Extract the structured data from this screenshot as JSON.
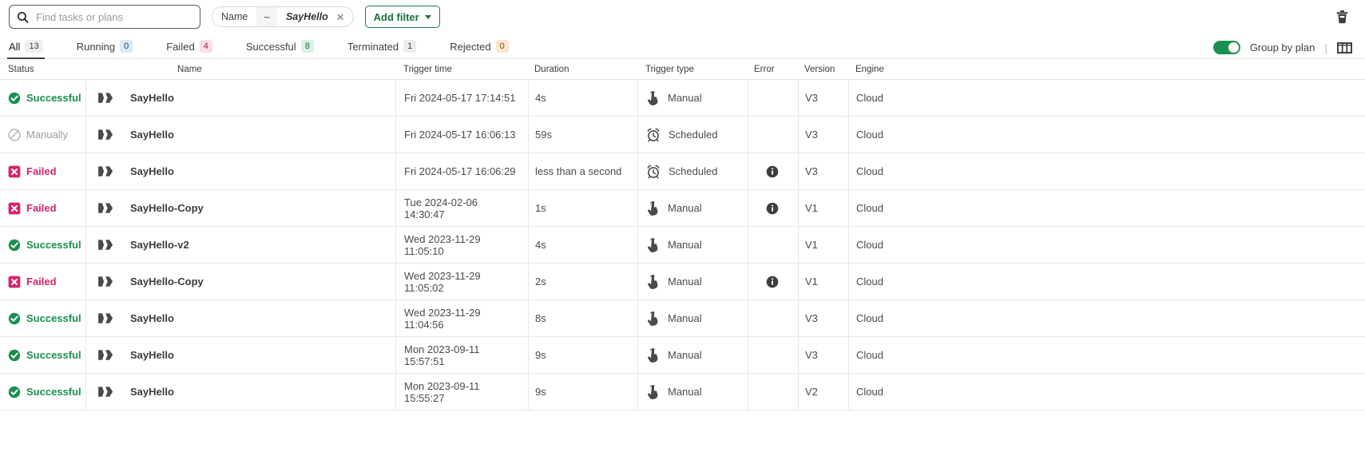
{
  "toolbar": {
    "search_placeholder": "Find tasks or plans",
    "search_value": "",
    "search_icon": "search-icon",
    "filter_chip": {
      "field": "Name",
      "operator": "~",
      "value": "SayHello",
      "remove_icon": "close-icon"
    },
    "add_filter_label": "Add filter",
    "delete_icon": "trash-icon"
  },
  "tabs": [
    {
      "label": "All",
      "count": "13",
      "active": true,
      "badge_bg": "#efefef",
      "badge_color": "#404040"
    },
    {
      "label": "Running",
      "count": "0",
      "active": false,
      "badge_bg": "#d6ebf7",
      "badge_color": "#2c4a5c"
    },
    {
      "label": "Failed",
      "count": "4",
      "active": false,
      "badge_bg": "#fbdce7",
      "badge_color": "#8c2a4c"
    },
    {
      "label": "Successful",
      "count": "8",
      "active": false,
      "badge_bg": "#d7f2e0",
      "badge_color": "#1f6b42"
    },
    {
      "label": "Terminated",
      "count": "1",
      "active": false,
      "badge_bg": "#ededed",
      "badge_color": "#404040"
    },
    {
      "label": "Rejected",
      "count": "0",
      "active": false,
      "badge_bg": "#fbe7cd",
      "badge_color": "#7a4f15"
    }
  ],
  "view_controls": {
    "group_by_plan_label": "Group by plan",
    "group_by_plan_on": true,
    "divider": "|",
    "columns_icon": "columns-icon"
  },
  "table": {
    "columns": [
      "Status",
      "Name",
      "Trigger time",
      "Duration",
      "Trigger type",
      "Error",
      "Version",
      "Engine"
    ],
    "rows": [
      {
        "status": "Successful",
        "status_icon": "check-circle-icon",
        "name": "SayHello",
        "name_icon": "task-icon",
        "trigger_time": "Fri 2024-05-17 17:14:51",
        "duration": "4s",
        "trigger_type": "Manual",
        "trigger_icon": "hand-pointer-icon",
        "error": "",
        "version": "V3",
        "engine": "Cloud"
      },
      {
        "status": "Manually",
        "status_icon": "ban-circle-icon",
        "name": "SayHello",
        "name_icon": "task-icon",
        "trigger_time": "Fri 2024-05-17 16:06:13",
        "duration": "59s",
        "trigger_type": "Scheduled",
        "trigger_icon": "alarm-clock-icon",
        "error": "",
        "version": "V3",
        "engine": "Cloud"
      },
      {
        "status": "Failed",
        "status_icon": "x-square-icon",
        "name": "SayHello",
        "name_icon": "task-icon",
        "trigger_time": "Fri 2024-05-17 16:06:29",
        "duration": "less than a second",
        "trigger_type": "Scheduled",
        "trigger_icon": "alarm-clock-icon",
        "error": "info-circle-icon",
        "version": "V3",
        "engine": "Cloud"
      },
      {
        "status": "Failed",
        "status_icon": "x-square-icon",
        "name": "SayHello-Copy",
        "name_icon": "task-icon",
        "trigger_time": "Tue 2024-02-06 14:30:47",
        "duration": "1s",
        "trigger_type": "Manual",
        "trigger_icon": "hand-pointer-icon",
        "error": "info-circle-icon",
        "version": "V1",
        "engine": "Cloud"
      },
      {
        "status": "Successful",
        "status_icon": "check-circle-icon",
        "name": "SayHello-v2",
        "name_icon": "task-icon",
        "trigger_time": "Wed 2023-11-29 11:05:10",
        "duration": "4s",
        "trigger_type": "Manual",
        "trigger_icon": "hand-pointer-icon",
        "error": "",
        "version": "V1",
        "engine": "Cloud"
      },
      {
        "status": "Failed",
        "status_icon": "x-square-icon",
        "name": "SayHello-Copy",
        "name_icon": "task-icon",
        "trigger_time": "Wed 2023-11-29 11:05:02",
        "duration": "2s",
        "trigger_type": "Manual",
        "trigger_icon": "hand-pointer-icon",
        "error": "info-circle-icon",
        "version": "V1",
        "engine": "Cloud"
      },
      {
        "status": "Successful",
        "status_icon": "check-circle-icon",
        "name": "SayHello",
        "name_icon": "task-icon",
        "trigger_time": "Wed 2023-11-29 11:04:56",
        "duration": "8s",
        "trigger_type": "Manual",
        "trigger_icon": "hand-pointer-icon",
        "error": "",
        "version": "V3",
        "engine": "Cloud"
      },
      {
        "status": "Successful",
        "status_icon": "check-circle-icon",
        "name": "SayHello",
        "name_icon": "task-icon",
        "trigger_time": "Mon 2023-09-11 15:57:51",
        "duration": "9s",
        "trigger_type": "Manual",
        "trigger_icon": "hand-pointer-icon",
        "error": "",
        "version": "V3",
        "engine": "Cloud"
      },
      {
        "status": "Successful",
        "status_icon": "check-circle-icon",
        "name": "SayHello",
        "name_icon": "task-icon",
        "trigger_time": "Mon 2023-09-11 15:55:27",
        "duration": "9s",
        "trigger_type": "Manual",
        "trigger_icon": "hand-pointer-icon",
        "error": "",
        "version": "V2",
        "engine": "Cloud"
      }
    ]
  },
  "colors": {
    "success": "#1a9050",
    "failed": "#d6246e",
    "muted": "#9c9c9c",
    "accent_green": "#16703f"
  }
}
